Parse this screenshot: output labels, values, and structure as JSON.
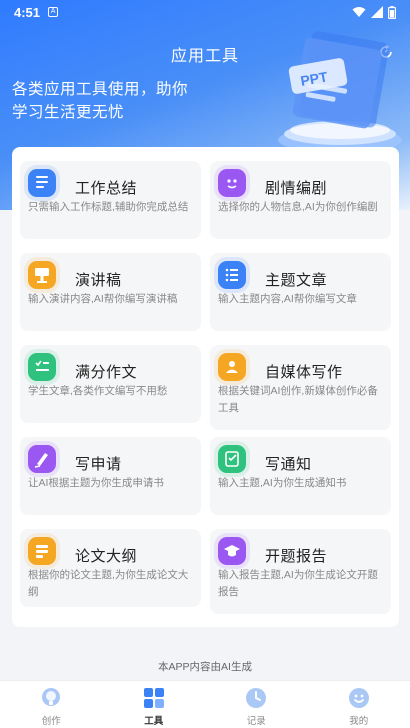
{
  "status_bar": {
    "time": "4:51",
    "notif_icon": "A"
  },
  "header": {
    "title": "应用工具",
    "refresh_icon": "refresh-icon"
  },
  "hero": {
    "tagline": "各类应用工具使用，助你学习生活更无忧",
    "illustration_text": "PPT"
  },
  "tools": [
    {
      "title": "工作总结",
      "desc": "只需输入工作标题,辅助你完成总结",
      "icon": "document-icon",
      "color": "#3a82f5"
    },
    {
      "title": "剧情编剧",
      "desc": "选择你的人物信息,AI为你创作编剧",
      "icon": "theater-icon",
      "color": "#9b57f2"
    },
    {
      "title": "演讲稿",
      "desc": "输入演讲内容,AI帮你编写演讲稿",
      "icon": "podium-icon",
      "color": "#f5a623"
    },
    {
      "title": "主题文章",
      "desc": "输入主题内容,AI帮你编写文章",
      "icon": "list-icon",
      "color": "#3a82f5"
    },
    {
      "title": "满分作文",
      "desc": "学生文章,各类作文编写不用愁",
      "icon": "checklist-icon",
      "color": "#2ec27e"
    },
    {
      "title": "自媒体写作",
      "desc": "根据关键词AI创作,新媒体创作必备工具",
      "icon": "profile-icon",
      "color": "#f5a623"
    },
    {
      "title": "写申请",
      "desc": "让AI根据主题为你生成申请书",
      "icon": "pen-icon",
      "color": "#9b57f2"
    },
    {
      "title": "写通知",
      "desc": "输入主题,AI为你生成通知书",
      "icon": "edit-icon",
      "color": "#2ec27e"
    },
    {
      "title": "论文大纲",
      "desc": "根据你的论文主题,为你生成论文大纲",
      "icon": "outline-icon",
      "color": "#f5a623"
    },
    {
      "title": "开题报告",
      "desc": "输入报告主题,AI为你生成论文开题报告",
      "icon": "graduation-cap-icon",
      "color": "#9b57f2"
    }
  ],
  "footer_note": "本APP内容由AI生成",
  "nav": [
    {
      "label": "创作",
      "icon": "lightbulb-icon"
    },
    {
      "label": "工具",
      "icon": "grid-icon"
    },
    {
      "label": "记录",
      "icon": "clock-icon"
    },
    {
      "label": "我的",
      "icon": "smiley-icon"
    }
  ],
  "colors": {
    "accent": "#3a82f5",
    "hero_top": "#2f7bff"
  }
}
